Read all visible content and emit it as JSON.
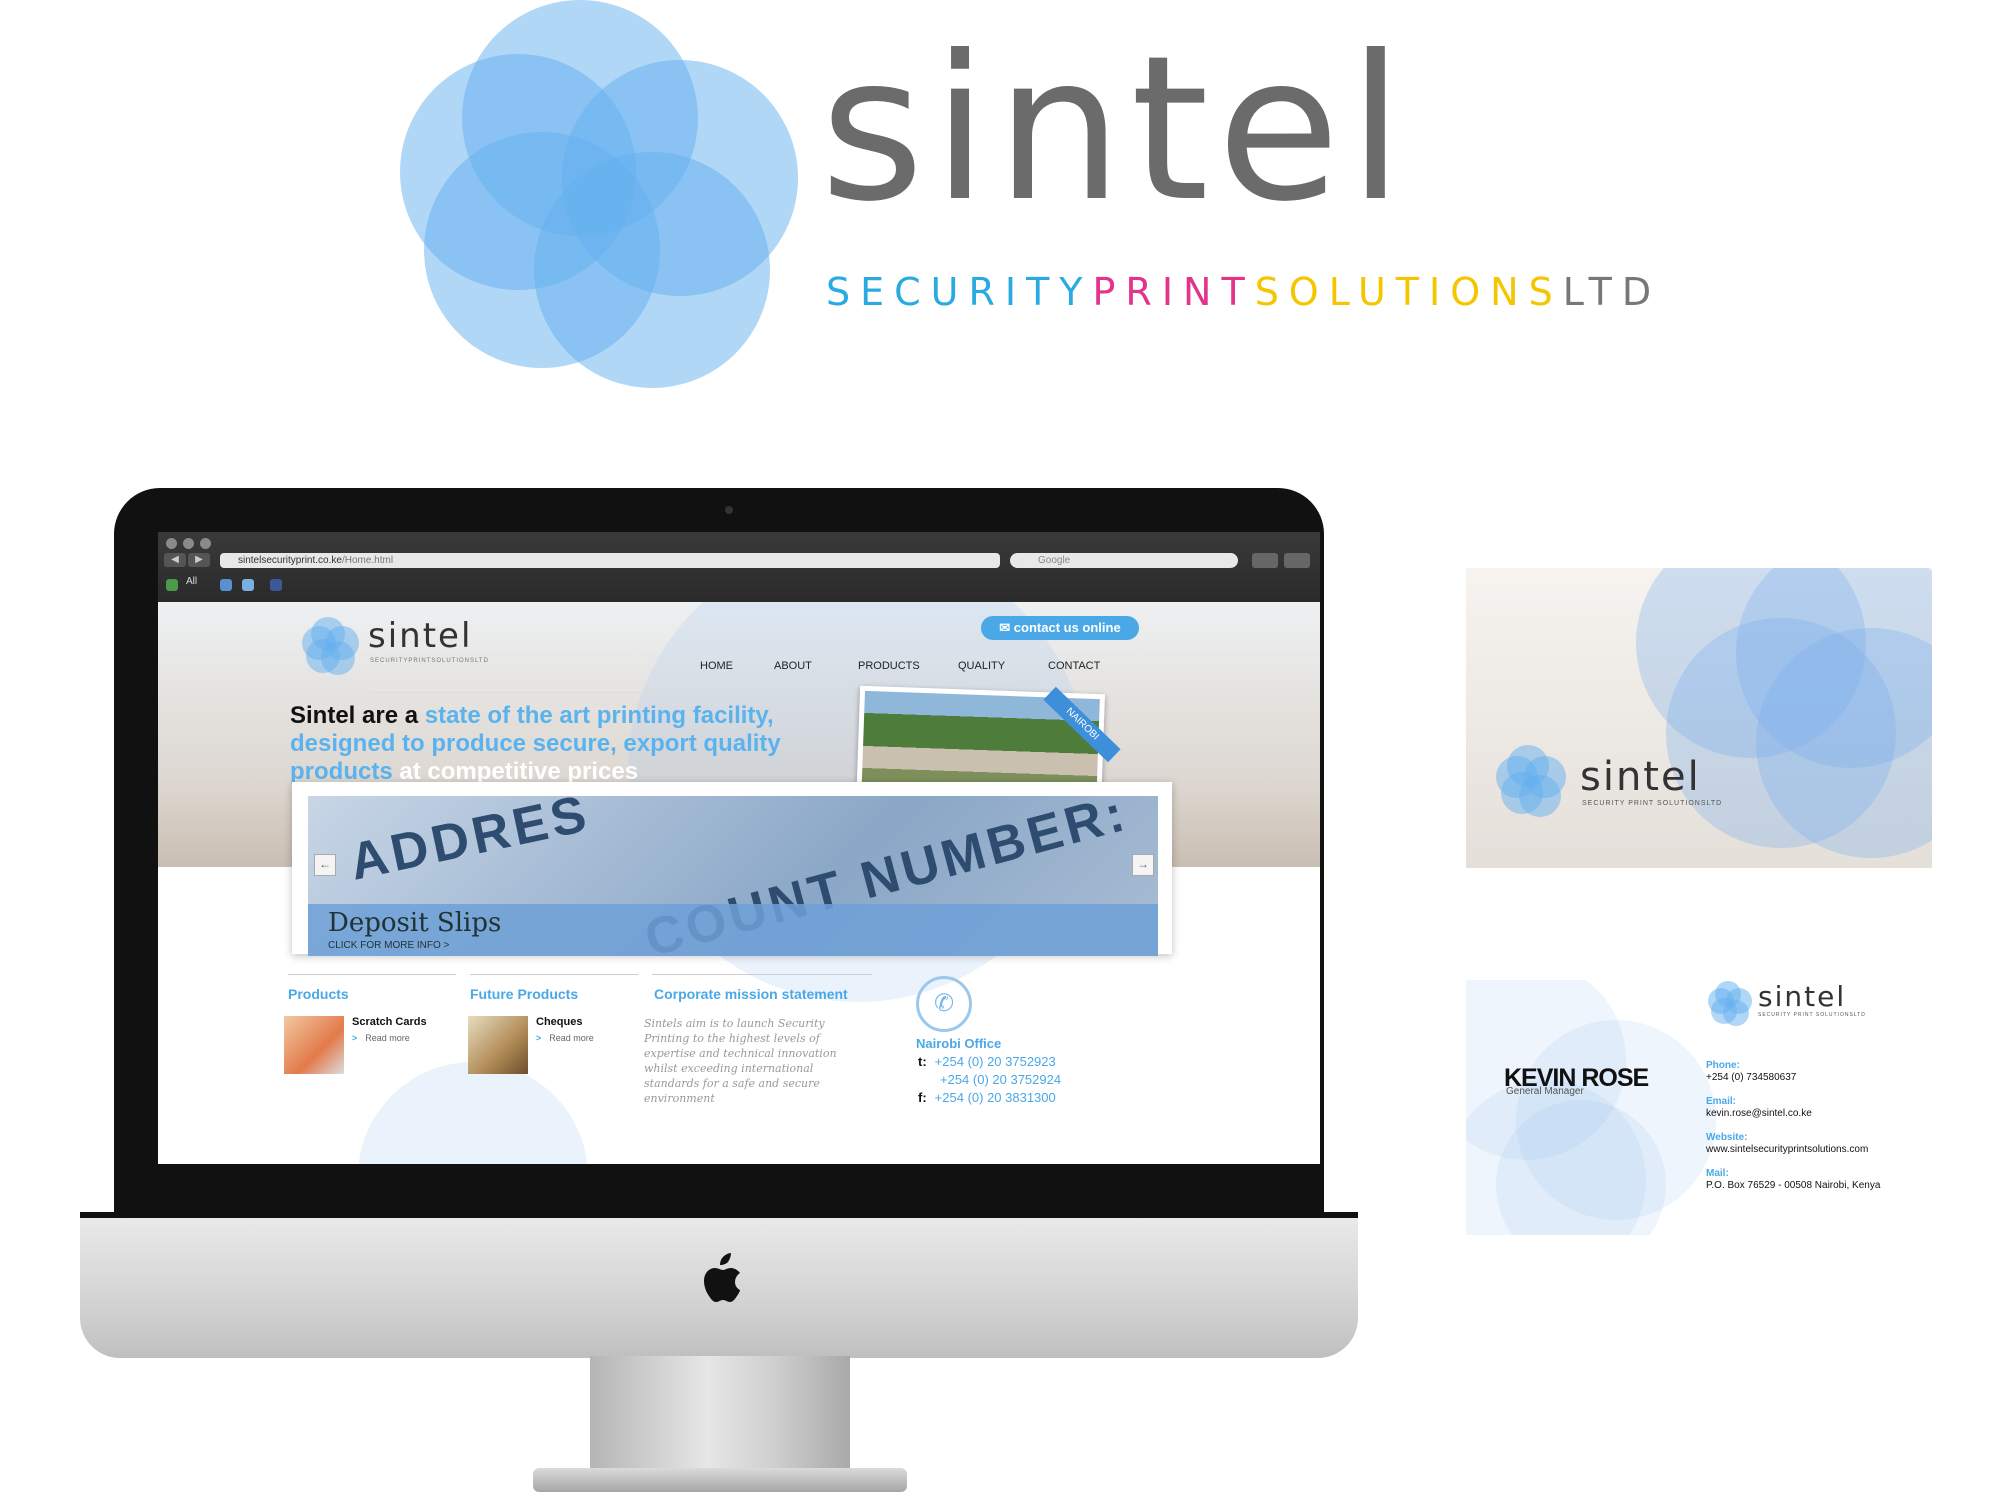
{
  "brand": {
    "word": "sintel",
    "tag_security": "SECURITY",
    "tag_print": "PRINT",
    "tag_solutions": "SOLUTIONS",
    "tag_ltd": "LTD"
  },
  "colors": {
    "logo_blue": "#64b0f0",
    "accent_blue": "#4aa8e6",
    "cyan": "#29abe2",
    "magenta": "#e4338a",
    "yellow": "#f5c500",
    "grey": "#6b6b6b"
  },
  "browser": {
    "url_host": "sintelsecurityprint.co.ke",
    "url_path": "/Home.html",
    "search_placeholder": "Google",
    "bookmark_all": "All"
  },
  "site": {
    "logo_word": "sintel",
    "logo_tag": "SECURITYPRINTSOLUTIONSLTD",
    "contact_label": "contact us online",
    "menu": [
      "HOME",
      "ABOUT",
      "PRODUCTS",
      "QUALITY",
      "CONTACT"
    ],
    "hero": {
      "p1": "Sintel are a ",
      "p2": "state of the art printing facility, designed to produce secure, export quality products",
      "p3": " at competitive prices"
    },
    "photo_ribbon": "NAIROBI",
    "slider": {
      "bg_word1": "ADDRES",
      "bg_word2": "COUNT NUMBER:",
      "title": "Deposit Slips",
      "subtitle": "CLICK FOR MORE INFO >",
      "prev": "←",
      "next": "→"
    },
    "columns": {
      "products_head": "Products",
      "future_head": "Future Products",
      "mission_head": "Corporate mission statement"
    },
    "items": {
      "scratch_title": "Scratch Cards",
      "cheques_title": "Cheques",
      "read_more": "Read more",
      "chev": ">"
    },
    "mission_text": "Sintels aim is to launch Security Printing to the highest levels of expertise and technical innovation whilst exceeding international standards for a safe and secure environment",
    "office": {
      "title": "Nairobi Office",
      "t_label": "t:",
      "phone1": "+254 (0) 20 3752923",
      "phone2": "+254 (0) 20 3752924",
      "f_label": "f:",
      "fax": "+254 (0) 20 3831300"
    }
  },
  "card_front": {
    "word": "sintel",
    "tag": "SECURITY PRINT SOLUTIONSLTD"
  },
  "card_back": {
    "name": "KEVIN ROSE",
    "role": "General Manager",
    "word": "sintel",
    "tag": "SECURITY PRINT SOLUTIONSLTD",
    "phone_label": "Phone:",
    "phone": "+254 (0) 734580637",
    "email_label": "Email:",
    "email": "kevin.rose@sintel.co.ke",
    "website_label": "Website:",
    "website": "www.sintelsecurityprintsolutions.com",
    "mail_label": "Mail:",
    "mail": "P.O. Box 76529 - 00508 Nairobi, Kenya"
  }
}
